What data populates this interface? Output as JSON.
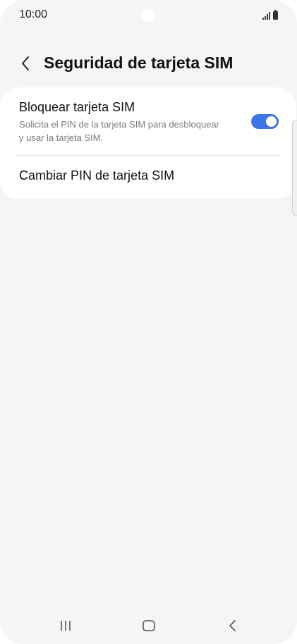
{
  "status_bar": {
    "time": "10:00",
    "icons": [
      "signal-icon",
      "battery-icon"
    ]
  },
  "header": {
    "back_icon": "chevron-left-icon",
    "title": "Seguridad de tarjeta SIM"
  },
  "settings": {
    "lock_sim": {
      "title": "Bloquear tarjeta SIM",
      "description": "Solicita el PIN de la tarjeta SIM para desbloquear y usar la tarjeta SIM.",
      "enabled": true
    },
    "change_pin": {
      "title": "Cambiar PIN de tarjeta SIM"
    }
  },
  "colors": {
    "accent": "#3e73e8",
    "background": "#f5f5f7",
    "card": "#ffffff",
    "secondary_text": "#7a7a7a"
  },
  "nav_bar": {
    "icons": [
      "recent-apps-icon",
      "home-icon",
      "back-icon"
    ]
  }
}
